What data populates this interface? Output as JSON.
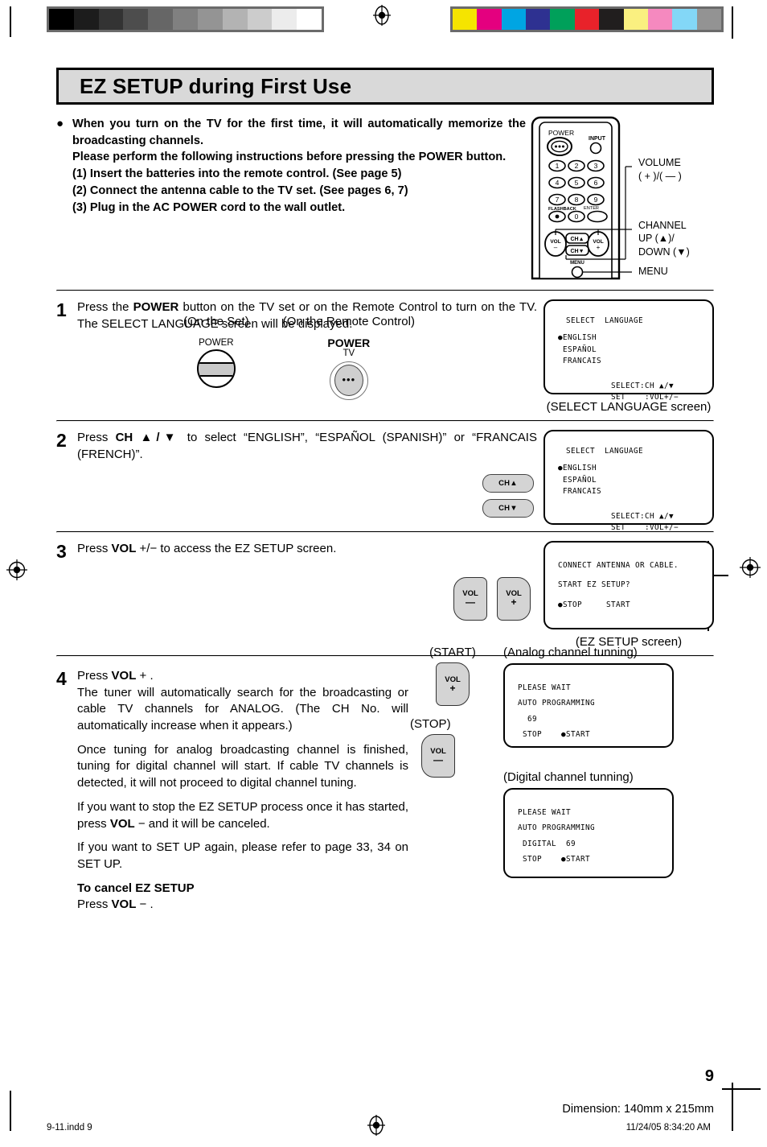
{
  "document": {
    "title": "EZ SETUP during First Use",
    "page_number": "9",
    "dimension_note": "Dimension: 140mm x 215mm",
    "footer_left": "9-11.indd   9",
    "footer_right": "11/24/05   8:34:20 AM"
  },
  "colors": {
    "title_bar_fill": "#d9d9d9",
    "button_fill": "#d4d4d4",
    "gray_bars": [
      "#000000",
      "#1c1c1c",
      "#333333",
      "#4d4d4d",
      "#666666",
      "#808080",
      "#949494",
      "#b3b3b3",
      "#cccccc",
      "#ececec",
      "#ffffff"
    ],
    "color_bars": [
      "#f5e400",
      "#e4007f",
      "#00a5e3",
      "#2e3191",
      "#00a05a",
      "#e8222a",
      "#211e1e",
      "#faf080",
      "#f589bf",
      "#83d7f7",
      "#939393"
    ]
  },
  "intro": {
    "bullet": "●",
    "lines": [
      "When you turn on the TV for the first time, it will automatically memorize the broadcasting channels.",
      "Please perform the following instructions before pressing the POWER button.",
      "(1) Insert the batteries into the remote control. (See page 5)",
      "(2) Connect the antenna cable to the TV set.  (See pages 6, 7)",
      "(3) Plug in the AC POWER cord to the wall outlet."
    ]
  },
  "remote": {
    "power_label": "POWER",
    "input_label": "INPUT",
    "keys": [
      "1",
      "2",
      "3",
      "4",
      "5",
      "6",
      "7",
      "8",
      "9"
    ],
    "flashback_label": "FLASHBACK",
    "enter_label": "ENTER",
    "zero_label": "0",
    "vol_minus": "VOL",
    "vol_plus": "VOL",
    "ch_up": "CH▲",
    "ch_down": "CH▼",
    "menu_label": "MENU",
    "callouts": {
      "volume_l1": "VOLUME",
      "volume_l2": "( + )/( — )",
      "channel_l1": "CHANNEL",
      "channel_l2": "UP (▲)/",
      "channel_l3": "DOWN (▼)",
      "menu": "MENU"
    }
  },
  "steps": [
    {
      "number": "1",
      "text_parts": [
        "Press the ",
        "POWER",
        " button on the TV set or on the Remote Control to turn on the TV. The SELECT LANGUAGE screen will be displayed."
      ],
      "on_the_set_label": "(On the Set)",
      "on_the_remote_label": "(On the Remote Control)",
      "set_button_label": "POWER",
      "remote_button_label": "POWER",
      "remote_button_sub": "TV",
      "screen": {
        "title": "SELECT  LANGUAGE",
        "options": [
          "●ENGLISH",
          " ESPAÑOL",
          " FRANCAIS"
        ],
        "hint1": "SELECT:CH ▲/▼",
        "hint2": "SET    :VOL+/−"
      },
      "caption": "(SELECT LANGUAGE screen)"
    },
    {
      "number": "2",
      "text_parts": [
        "Press ",
        "CH ▲/▼",
        " to select “ENGLISH”, “ESPAÑOL (SPANISH)” or “FRANCAIS (FRENCH)”."
      ],
      "button_up": "CH▲",
      "button_down": "CH▼",
      "screen": {
        "title": "SELECT  LANGUAGE",
        "options": [
          "●ENGLISH",
          " ESPAÑOL",
          " FRANCAIS"
        ],
        "hint1": "SELECT:CH ▲/▼",
        "hint2": "SET    :VOL+/−"
      },
      "caption": ""
    },
    {
      "number": "3",
      "text_parts": [
        "Press ",
        "VOL",
        " +/− to access the EZ SETUP screen."
      ],
      "button_minus_l1": "VOL",
      "button_minus_l2": "—",
      "button_plus_l1": "VOL",
      "button_plus_l2": "+",
      "screen": {
        "line1": "CONNECT ANTENNA OR CABLE.",
        "line2": "START EZ SETUP?",
        "line3": "●STOP     START"
      },
      "caption": "(EZ SETUP screen)"
    }
  ],
  "step4": {
    "number": "4",
    "paragraphs": [
      {
        "lead": "Press ",
        "bold": "VOL",
        "tail": " + ."
      },
      {
        "text": "The tuner will automatically search for the broadcasting or cable TV channels for ANALOG. (The CH No. will automatically increase when it appears.)"
      },
      {
        "text": "Once tuning for analog broadcasting channel is finished, tuning for digital channel will start. If cable TV channels is detected, it will not proceed to digital channel tuning."
      },
      {
        "pre": "If you want to stop the EZ SETUP process once it has started, press ",
        "bold": "VOL",
        "post": " −  and it will be canceled."
      },
      {
        "text": "If you want to SET UP again, please refer to page 33, 34 on SET UP."
      }
    ],
    "cancel_heading": "To cancel EZ SETUP",
    "cancel_lead": "Press ",
    "cancel_bold": "VOL",
    "cancel_tail": " − .",
    "start_label": "(START)",
    "stop_label": "(STOP)",
    "start_button_l1": "VOL",
    "start_button_l2": "+",
    "stop_button_l1": "VOL",
    "stop_button_l2": "—",
    "analog_caption": "(Analog channel tunning)",
    "analog_screen": {
      "line1": "PLEASE WAIT",
      "line2": "AUTO PROGRAMMING",
      "line3": "  69",
      "line4": " STOP    ●START"
    },
    "digital_caption": "(Digital channel tunning)",
    "digital_screen": {
      "line1": "PLEASE WAIT",
      "line2": "AUTO PROGRAMMING",
      "line3": " DIGITAL  69",
      "line4": " STOP    ●START"
    }
  }
}
